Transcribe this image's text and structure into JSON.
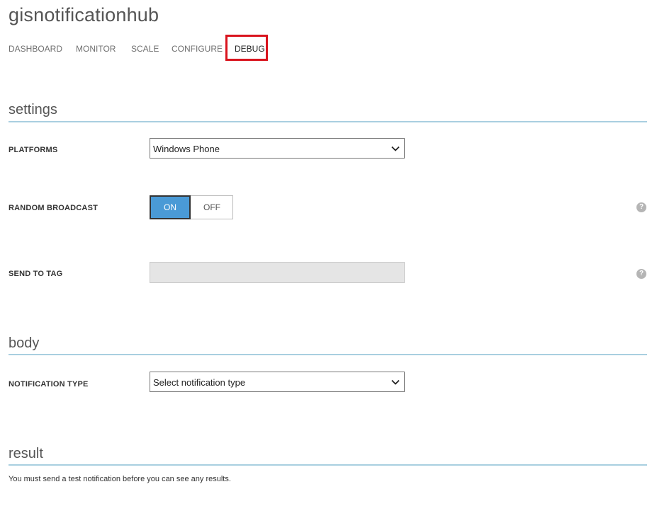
{
  "header": {
    "title": "gisnotificationhub"
  },
  "tabs": [
    {
      "label": "DASHBOARD"
    },
    {
      "label": "MONITOR"
    },
    {
      "label": "SCALE"
    },
    {
      "label": "CONFIGURE"
    },
    {
      "label": "DEBUG",
      "active": true
    }
  ],
  "settings": {
    "heading": "settings",
    "platforms": {
      "label": "PLATFORMS",
      "value": "Windows Phone"
    },
    "random_broadcast": {
      "label": "RANDOM BROADCAST",
      "on_label": "ON",
      "off_label": "OFF",
      "state": "ON"
    },
    "send_to_tag": {
      "label": "SEND TO TAG",
      "value": ""
    },
    "help_glyph": "?"
  },
  "body": {
    "heading": "body",
    "notification_type": {
      "label": "NOTIFICATION TYPE",
      "value": "Select notification type"
    }
  },
  "result": {
    "heading": "result",
    "message": "You must send a test notification before you can see any results."
  },
  "colors": {
    "accent_blue": "#4a9ad6",
    "highlight_red": "#d9141e",
    "section_rule": "#a9cfe0"
  },
  "icons": {
    "dropdown": "chevron-down-icon",
    "help": "question-circle-icon"
  }
}
